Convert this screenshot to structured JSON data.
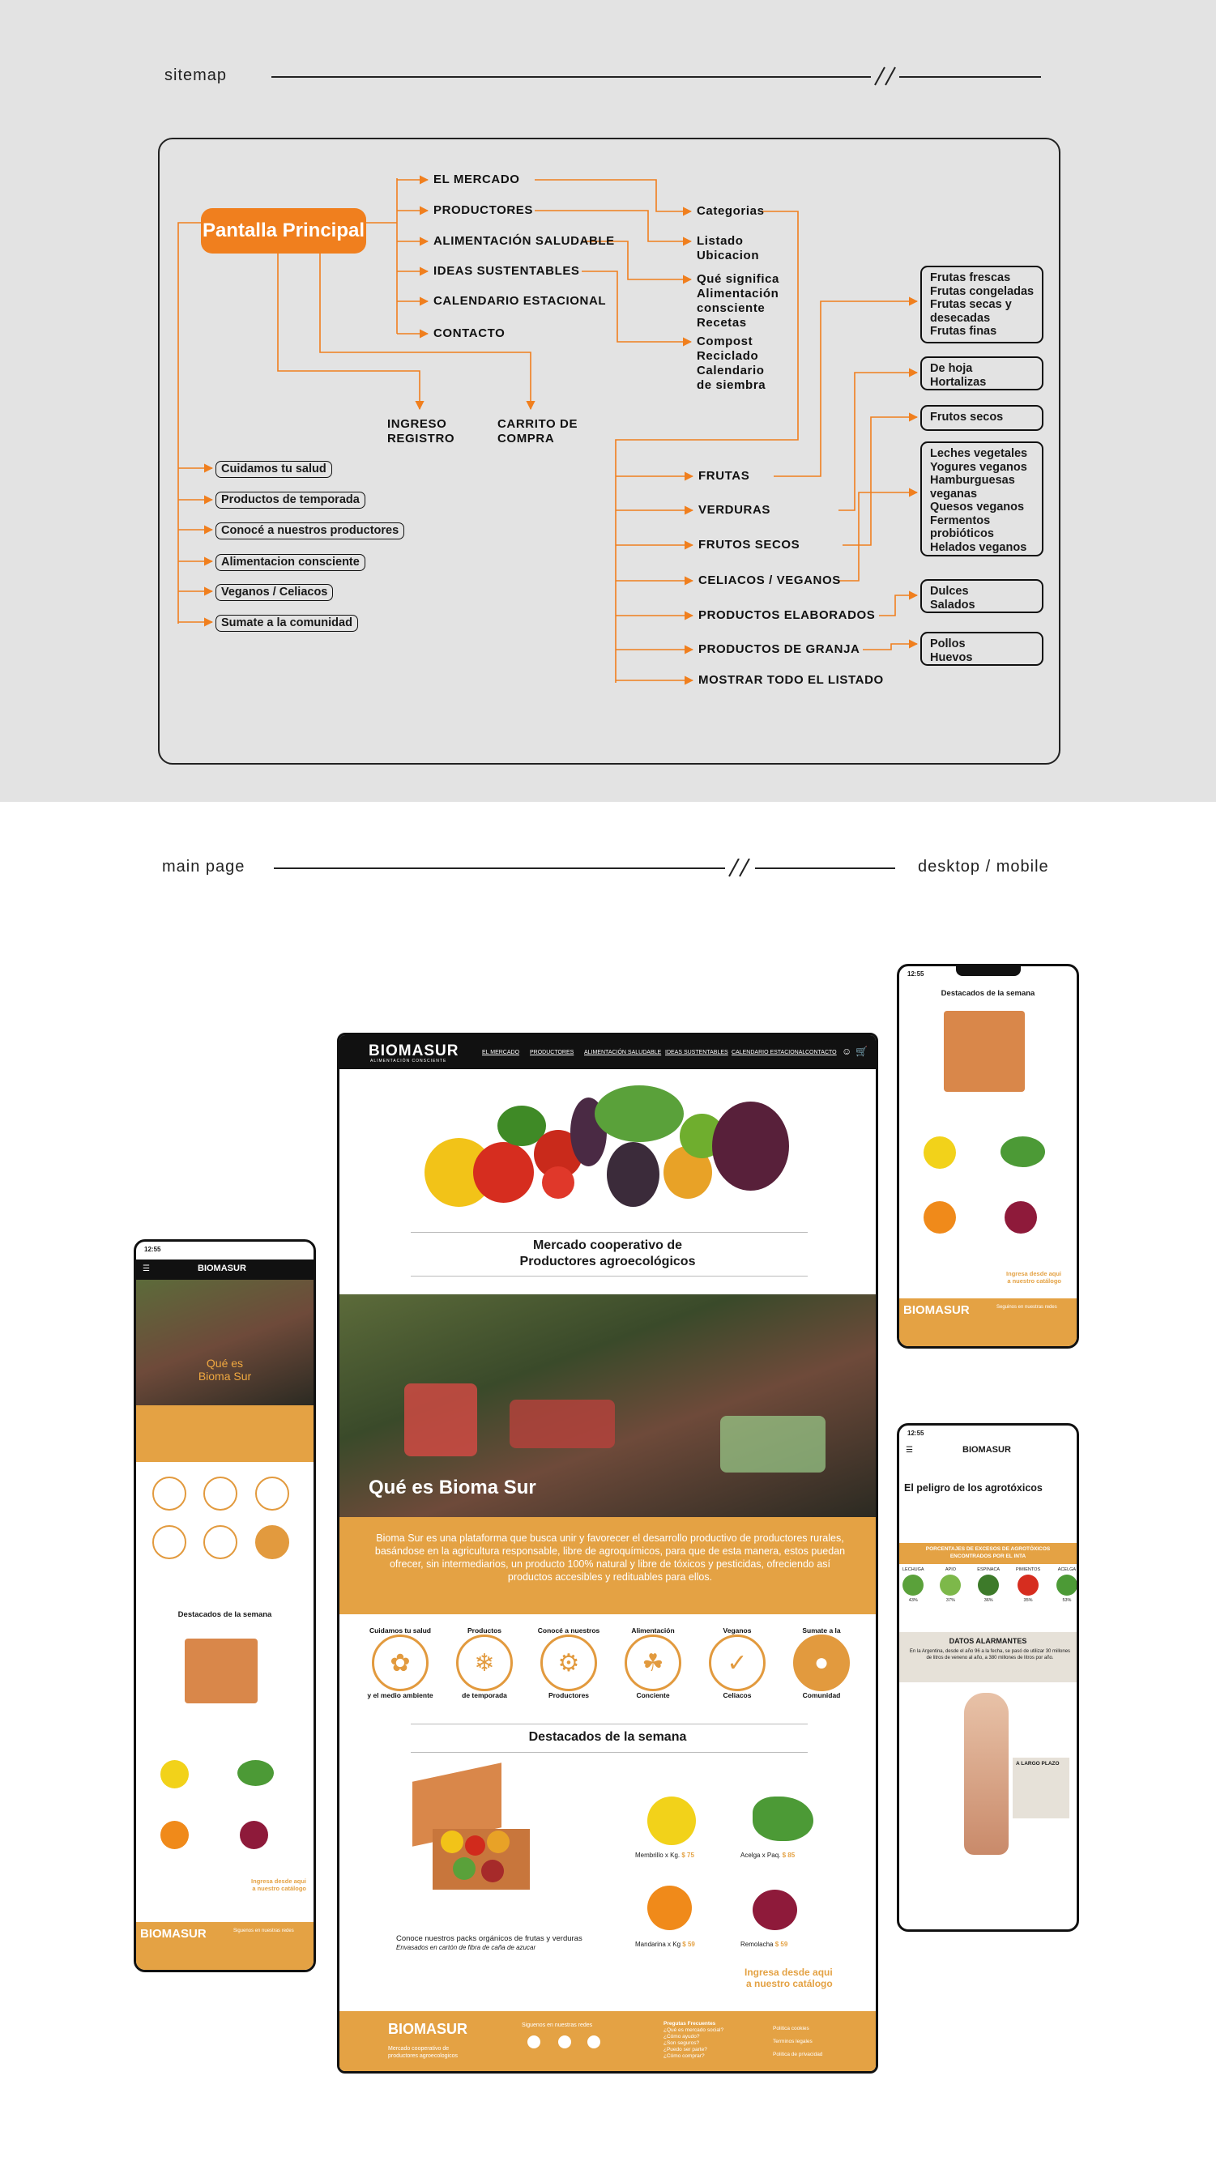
{
  "sections": {
    "sitemap_label": "sitemap",
    "main_page_label": "main page",
    "device_label": "desktop / mobile"
  },
  "sitemap": {
    "root": "Pantalla Principal",
    "level1": [
      "EL MERCADO",
      "PRODUCTORES",
      "ALIMENTACIÓN SALUDABLE",
      "IDEAS SUSTENTABLES",
      "CALENDARIO ESTACIONAL",
      "CONTACTO"
    ],
    "account": [
      "INGRESO",
      "REGISTRO"
    ],
    "cart": [
      "CARRITO DE",
      "COMPRA"
    ],
    "sub": {
      "categorias": "Categorias",
      "listado": [
        "Listado",
        "Ubicacion"
      ],
      "que_significa": [
        "Qué significa",
        "Alimentación",
        "consciente",
        "Recetas"
      ],
      "compost": [
        "Compost",
        "Reciclado",
        "Calendario",
        "de siembra"
      ]
    },
    "home_sections": [
      "Cuidamos tu salud",
      "Productos de temporada",
      "Conocé a nuestros productores",
      "Alimentacion consciente",
      "Veganos / Celiacos",
      "Sumate a la comunidad"
    ],
    "categories": [
      "FRUTAS",
      "VERDURAS",
      "FRUTOS SECOS",
      "CELIACOS / VEGANOS",
      "PRODUCTOS ELABORADOS",
      "PRODUCTOS DE GRANJA",
      "MOSTRAR TODO EL LISTADO"
    ],
    "boxes": [
      [
        "Frutas frescas",
        "Frutas congeladas",
        "Frutas secas y",
        "desecadas",
        "Frutas finas"
      ],
      [
        "De hoja",
        "Hortalizas"
      ],
      [
        "Frutos secos"
      ],
      [
        "Leches vegetales",
        "Yogures veganos",
        "Hamburguesas",
        "veganas",
        "Quesos veganos",
        "Fermentos",
        "probióticos",
        "Helados veganos"
      ],
      [
        "Dulces",
        "Salados"
      ],
      [
        "Pollos",
        "Huevos"
      ]
    ]
  },
  "desktop": {
    "brand": "BIOMASUR",
    "brand_sub": "ALIMENTACIÓN CONSCIENTE",
    "nav": [
      "EL MERCADO",
      "PRODUCTORES",
      "ALIMENTACIÓN SALUDABLE",
      "IDEAS SUSTENTABLES",
      "CALENDARIO ESTACIONAL",
      "CONTACTO"
    ],
    "hero_title_1": "Mercado cooperativo de",
    "hero_title_2": "Productores agroecológicos",
    "que_es": "Qué es Bioma Sur",
    "about": "Bioma Sur es una plataforma que busca unir y favorecer el desarrollo productivo de productores rurales, basándose en la agricultura responsable, libre de agroquímicos, para que de esta manera, estos puedan ofrecer, sin intermediarios, un producto 100% natural y libre de tóxicos y pesticidas, ofreciendo así productos accesibles y redituables para ellos.",
    "categories": [
      {
        "top": "Cuidamos tu salud",
        "bottom": "y el medio ambiente"
      },
      {
        "top": "Productos",
        "bottom": "de temporada"
      },
      {
        "top": "Conocé a nuestros",
        "bottom": "Productores"
      },
      {
        "top": "Alimentación",
        "bottom": "Conciente"
      },
      {
        "top": "Veganos",
        "bottom": "Celiacos"
      },
      {
        "top": "Sumate a la",
        "bottom": "Comunidad"
      }
    ],
    "destacados": "Destacados de la semana",
    "box_caption": "Conoce nuestros packs orgánicos de frutas y verduras",
    "box_caption_2": "Envasados en cartón de fibra de caña de azucar",
    "products": [
      {
        "name": "Membrillo x Kg.",
        "price": "$ 75"
      },
      {
        "name": "Acelga x Paq.",
        "price": "$ 85"
      },
      {
        "name": "Mandarina x Kg",
        "price": "$ 59"
      },
      {
        "name": "Remolacha",
        "price": "$ 59"
      }
    ],
    "cta_1": "Ingresa desde aqui",
    "cta_2": "a nuestro catálogo",
    "footer": {
      "tagline_1": "Mercado cooperativo de",
      "tagline_2": "productores agroecologicos",
      "social_title": "Siguenos en nuestras redes",
      "faq_title": "Pregutas Frecuentes",
      "faq": [
        "¿Qué es mercado social?",
        "¿Cómo ayudo?",
        "¿Son seguros?",
        "¿Puedo ser parte?",
        "¿Cómo comprar?"
      ],
      "links": [
        "Politica cookies",
        "Terminos legales",
        "Politica de privacidad"
      ]
    }
  },
  "mobile_left": {
    "time": "12:55",
    "brand": "BIOMASUR",
    "que_es_1": "Qué es",
    "que_es_2": "Bioma Sur",
    "destacados": "Destacados de la semana",
    "cta_1": "Ingresa desde aqui",
    "cta_2": "a nuestro catálogo",
    "social_title": "Siguenos en nuestras redes"
  },
  "mobile_right_top": {
    "time": "12:55",
    "destacados": "Destacados de la semana",
    "cta_1": "Ingresa desde aqui",
    "cta_2": "a nuestro catálogo",
    "brand": "BIOMASUR",
    "social_title": "Seguinos en nuestras redes"
  },
  "mobile_right_bottom": {
    "time": "12:55",
    "brand": "BIOMASUR",
    "title": "El peligro de los agrotóxicos",
    "bar_title_1": "PORCENTAJES DE EXCESOS DE AGROTÓXICOS",
    "bar_title_2": "ENCONTRADOS POR EL INTA",
    "veg": [
      "LECHUGA",
      "APIO",
      "ESPINACA",
      "PIMIENTOS",
      "ACELGA"
    ],
    "pct": [
      "43%",
      "37%",
      "36%",
      "35%",
      "53%"
    ],
    "datos": "DATOS ALARMANTES",
    "datos_text": "En la Argentina, desde el año 96 a la fecha, se pasó de utilizar 30 millones de litros de veneno al año, a 380 millones de litros por año.",
    "plazo": "A LARGO PLAZO"
  },
  "colors": {
    "accent": "#f07f1e",
    "brand_orange": "#e4a244",
    "bg_top": "#e3e3e3"
  }
}
